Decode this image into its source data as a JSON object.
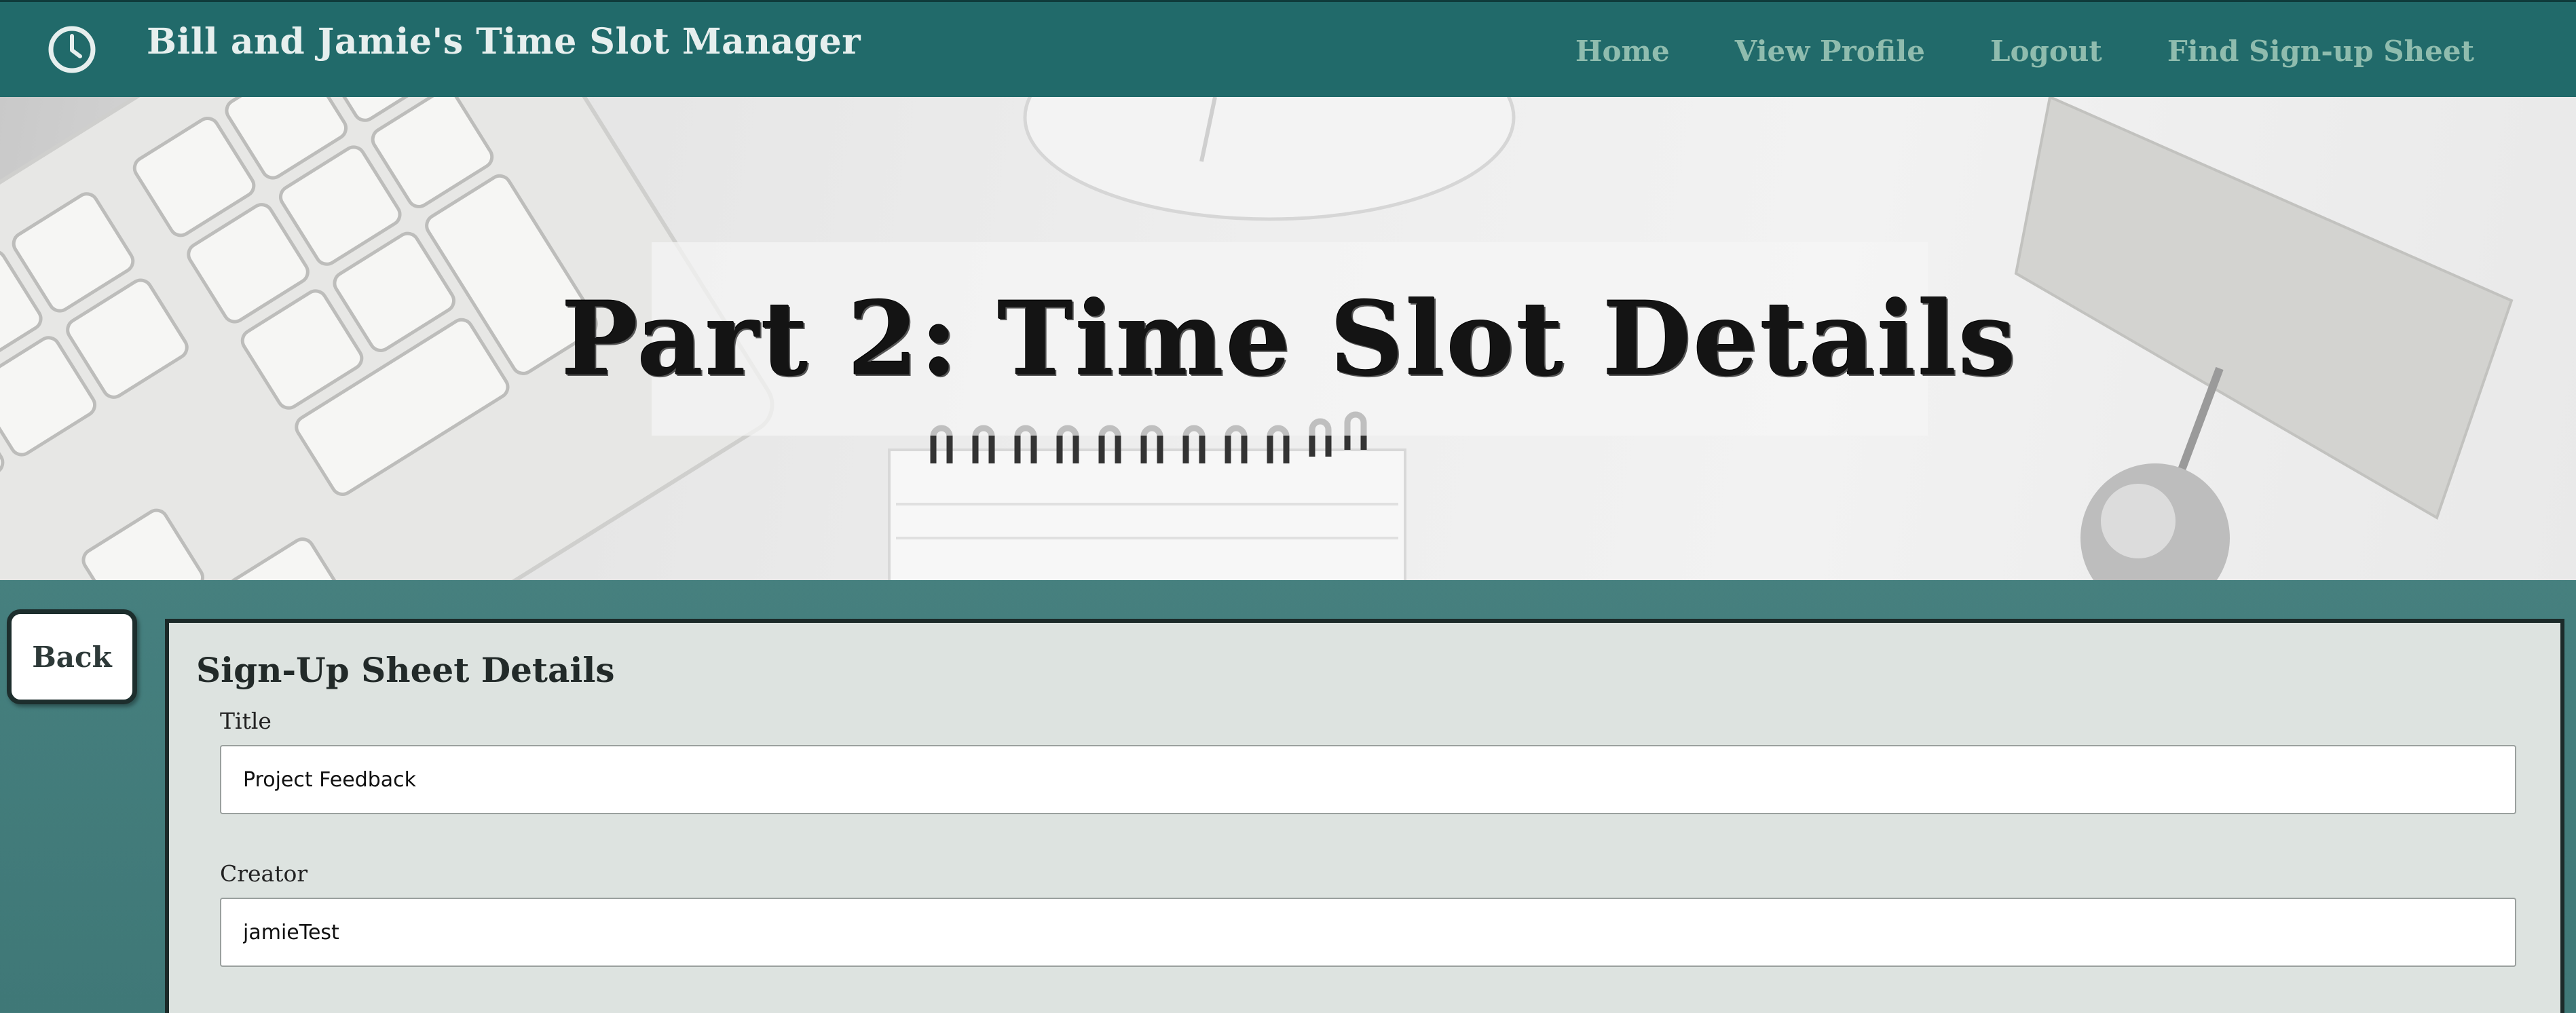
{
  "header": {
    "brand": "Bill and Jamie's Time Slot Manager",
    "logo_icon": "clock-icon",
    "nav": [
      {
        "label": "Home"
      },
      {
        "label": "View Profile"
      },
      {
        "label": "Logout"
      },
      {
        "label": "Find Sign-up Sheet"
      }
    ]
  },
  "hero": {
    "title": "Part 2: Time Slot Details"
  },
  "back_button": {
    "label": "Back"
  },
  "details": {
    "heading": "Sign-Up Sheet Details",
    "fields": [
      {
        "label": "Title",
        "value": "Project Feedback"
      },
      {
        "label": "Creator",
        "value": "jamieTest"
      }
    ]
  },
  "colors": {
    "nav_bg": "#216a6a",
    "nav_link": "#8fbcae",
    "page_bg": "#4f8a89",
    "panel_bg": "#dde3e0"
  }
}
